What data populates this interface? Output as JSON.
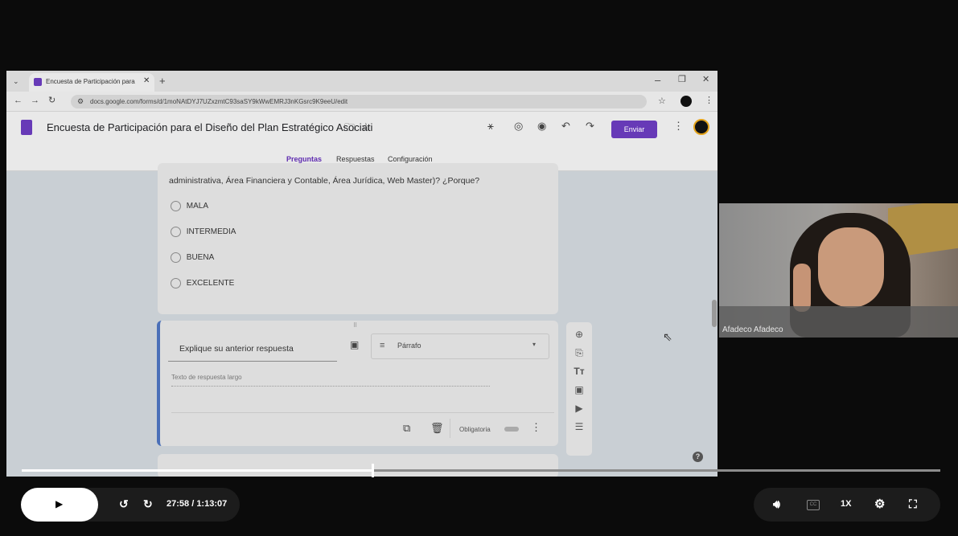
{
  "browser": {
    "tab_title": "Encuesta de Participación para",
    "url": "docs.google.com/forms/d/1moNAtDYJ7UZxzmtC93saSY9kWwEMRJ3nKGsrc9K9eeU/edit"
  },
  "form": {
    "title": "Encuesta de Participación para el Diseño del Plan Estratégico Asociati",
    "send_label": "Enviar",
    "tabs": [
      "Preguntas",
      "Respuestas",
      "Configuración"
    ],
    "accent": "#673ab7"
  },
  "question1": {
    "text": "administrativa, Área Financiera y Contable, Área Jurídica, Web Master)? ¿Porque?",
    "options": [
      "MALA",
      "INTERMEDIA",
      "BUENA",
      "EXCELENTE"
    ]
  },
  "question2": {
    "title": "Explique su anterior respuesta",
    "type": "Párrafo",
    "placeholder": "Texto de respuesta largo",
    "required_label": "Obligatoria"
  },
  "webcam": {
    "name": "Afadeco Afadeco"
  },
  "player": {
    "current_time": "27:58",
    "separator": " / ",
    "duration": "1:13:07",
    "progress": 0.382,
    "speed": "1X"
  }
}
